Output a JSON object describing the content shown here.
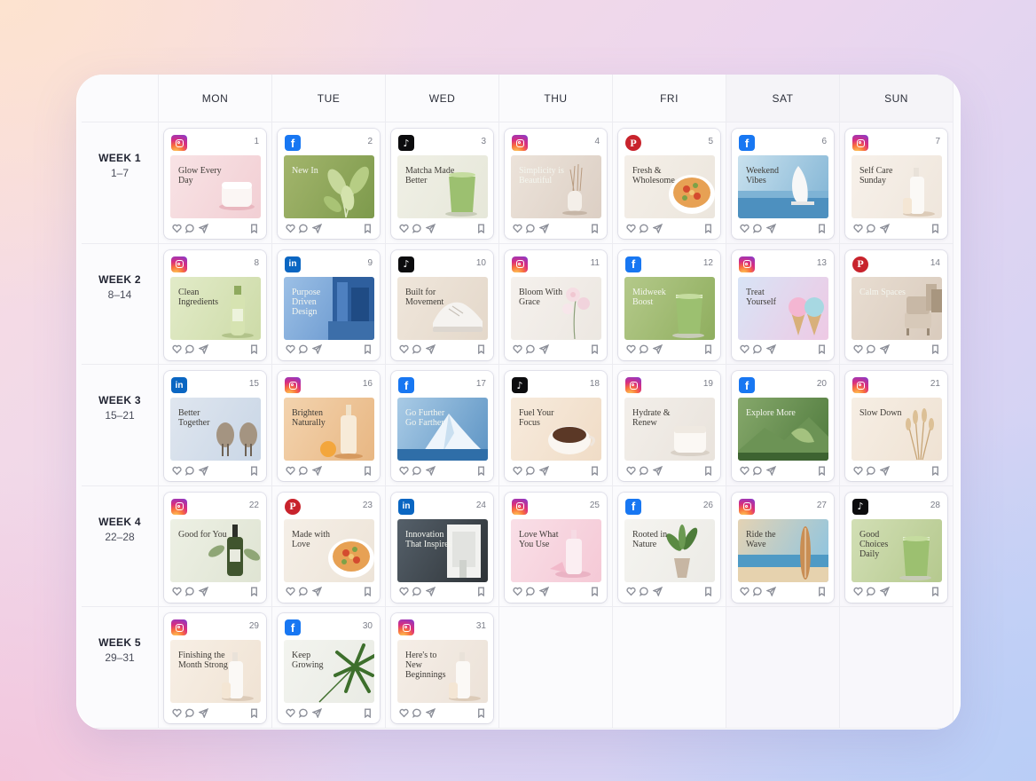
{
  "days": [
    "MON",
    "TUE",
    "WED",
    "THU",
    "FRI",
    "SAT",
    "SUN"
  ],
  "weeks": [
    {
      "label": "WEEK 1",
      "range": "1–7"
    },
    {
      "label": "WEEK 2",
      "range": "8–14"
    },
    {
      "label": "WEEK 3",
      "range": "15–21"
    },
    {
      "label": "WEEK 4",
      "range": "22–28"
    },
    {
      "label": "WEEK 5",
      "range": "29–31"
    }
  ],
  "posts": [
    {
      "day": "1",
      "platform": "instagram",
      "caption": "Glow Every Day",
      "bg": "#f2cfd4",
      "bg2": "#f8e3e5",
      "prod": "jar",
      "light": false
    },
    {
      "day": "2",
      "platform": "facebook",
      "caption": "New In",
      "bg": "#7d9a4c",
      "bg2": "#a3b56c",
      "prod": "leaf",
      "light": true
    },
    {
      "day": "3",
      "platform": "tiktok",
      "caption": "Matcha Made Better",
      "bg": "#e6e7d9",
      "bg2": "#f0f0e6",
      "prod": "glass-green",
      "light": false
    },
    {
      "day": "4",
      "platform": "instagram",
      "caption": "Simplicity is Beautiful",
      "bg": "#dccfc4",
      "bg2": "#ece3da",
      "prod": "vase",
      "light": true
    },
    {
      "day": "5",
      "platform": "pinterest",
      "caption": "Fresh & Wholesome",
      "bg": "#ece6dd",
      "bg2": "#f4efe8",
      "prod": "bowl",
      "light": false
    },
    {
      "day": "6",
      "platform": "facebook",
      "caption": "Weekend Vibes",
      "bg": "#7fb3d4",
      "bg2": "#c9e1ee",
      "prod": "boat",
      "light": false
    },
    {
      "day": "7",
      "platform": "instagram",
      "caption": "Self Care Sunday",
      "bg": "#efe6dc",
      "bg2": "#f7f1ea",
      "prod": "bottle",
      "light": false
    },
    {
      "day": "8",
      "platform": "instagram",
      "caption": "Clean Ingredients",
      "bg": "#cddba8",
      "bg2": "#e2ebc8",
      "prod": "bottle-green",
      "light": false
    },
    {
      "day": "9",
      "platform": "linkedin",
      "caption": "Purpose Driven Design",
      "bg": "#5d8ec9",
      "bg2": "#9cc0e6",
      "prod": "building",
      "light": true
    },
    {
      "day": "10",
      "platform": "tiktok",
      "caption": "Built for Movement",
      "bg": "#e4d8ca",
      "bg2": "#efe6db",
      "prod": "shoe",
      "light": false
    },
    {
      "day": "11",
      "platform": "instagram",
      "caption": "Bloom With Grace",
      "bg": "#ece7e1",
      "bg2": "#f5f1ed",
      "prod": "flower",
      "light": false
    },
    {
      "day": "12",
      "platform": "facebook",
      "caption": "Midweek Boost",
      "bg": "#8fae5e",
      "bg2": "#b4c98a",
      "prod": "glass-green",
      "light": true
    },
    {
      "day": "13",
      "platform": "instagram",
      "caption": "Treat Yourself",
      "bg": "#eec9e4",
      "bg2": "#d8e4f6",
      "prod": "icecream",
      "light": false
    },
    {
      "day": "14",
      "platform": "pinterest",
      "caption": "Calm Spaces",
      "bg": "#d9cbbd",
      "bg2": "#e8ddd1",
      "prod": "chair",
      "light": true
    },
    {
      "day": "15",
      "platform": "linkedin",
      "caption": "Better Together",
      "bg": "#c9d6e6",
      "bg2": "#dfe6ef",
      "prod": "chairs",
      "light": false
    },
    {
      "day": "16",
      "platform": "instagram",
      "caption": "Brighten Naturally",
      "bg": "#e8b783",
      "bg2": "#f3d3ae",
      "prod": "serum",
      "light": false
    },
    {
      "day": "17",
      "platform": "facebook",
      "caption": "Go Further Go Farther",
      "bg": "#5d94c4",
      "bg2": "#a9cbe6",
      "prod": "ice",
      "light": true
    },
    {
      "day": "18",
      "platform": "tiktok",
      "caption": "Fuel Your Focus",
      "bg": "#f0dcc6",
      "bg2": "#f7ebdd",
      "prod": "cup",
      "light": false
    },
    {
      "day": "19",
      "platform": "instagram",
      "caption": "Hydrate & Renew",
      "bg": "#e9e3dc",
      "bg2": "#f3efea",
      "prod": "jar-white",
      "light": false
    },
    {
      "day": "20",
      "platform": "facebook",
      "caption": "Explore More",
      "bg": "#4f7a3d",
      "bg2": "#86a86b",
      "prod": "mountain",
      "light": true
    },
    {
      "day": "21",
      "platform": "instagram",
      "caption": "Slow Down",
      "bg": "#efe2d3",
      "bg2": "#f6eee4",
      "prod": "grass",
      "light": false
    },
    {
      "day": "22",
      "platform": "instagram",
      "caption": "Good for You",
      "bg": "#dfe4d3",
      "bg2": "#edf0e4",
      "prod": "dropper",
      "light": false
    },
    {
      "day": "23",
      "platform": "pinterest",
      "caption": "Made with Love",
      "bg": "#ede4d8",
      "bg2": "#f5efe7",
      "prod": "bowl",
      "light": false
    },
    {
      "day": "24",
      "platform": "linkedin",
      "caption": "Innovation That Inspires",
      "bg": "#2e3337",
      "bg2": "#55606a",
      "prod": "device",
      "light": true
    },
    {
      "day": "25",
      "platform": "instagram",
      "caption": "Love What You Use",
      "bg": "#f5c9d6",
      "bg2": "#f9dfe7",
      "prod": "bottle-pink",
      "light": false
    },
    {
      "day": "26",
      "platform": "facebook",
      "caption": "Rooted in Nature",
      "bg": "#ecebe6",
      "bg2": "#f5f4f0",
      "prod": "plant",
      "light": false
    },
    {
      "day": "27",
      "platform": "instagram",
      "caption": "Ride the Wave",
      "bg": "#86c3e4",
      "bg2": "#e4d3b4",
      "prod": "surf",
      "light": false
    },
    {
      "day": "28",
      "platform": "tiktok",
      "caption": "Good Choices Daily",
      "bg": "#b5c98e",
      "bg2": "#d2dfb5",
      "prod": "glass-green",
      "light": false
    },
    {
      "day": "29",
      "platform": "instagram",
      "caption": "Finishing the Month Strong",
      "bg": "#f0e3d4",
      "bg2": "#f7efe5",
      "prod": "bottle",
      "light": false
    },
    {
      "day": "30",
      "platform": "facebook",
      "caption": "Keep Growing",
      "bg": "#e9ebe4",
      "bg2": "#f3f4ef",
      "prod": "palm",
      "light": false
    },
    {
      "day": "31",
      "platform": "instagram",
      "caption": "Here's to New Beginnings",
      "bg": "#ece2d8",
      "bg2": "#f5eee7",
      "prod": "bottle",
      "light": false
    }
  ]
}
